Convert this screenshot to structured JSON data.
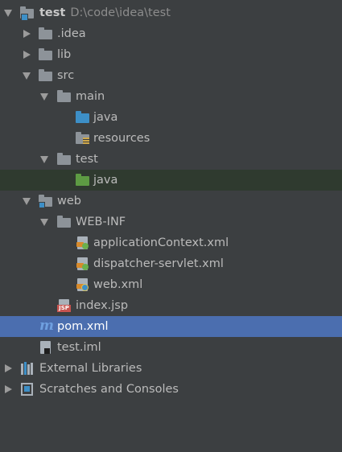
{
  "project_tree": {
    "root": {
      "name": "test",
      "path": "D:\\code\\idea\\test"
    },
    "items": [
      {
        "label": ".idea"
      },
      {
        "label": "lib"
      },
      {
        "label": "src"
      },
      {
        "label": "main"
      },
      {
        "label": "java"
      },
      {
        "label": "resources"
      },
      {
        "label": "test"
      },
      {
        "label": "java"
      },
      {
        "label": "web"
      },
      {
        "label": "WEB-INF"
      },
      {
        "label": "applicationContext.xml"
      },
      {
        "label": "dispatcher-servlet.xml"
      },
      {
        "label": "web.xml"
      },
      {
        "label": "index.jsp"
      },
      {
        "label": "pom.xml"
      },
      {
        "label": "test.iml"
      },
      {
        "label": "External Libraries"
      },
      {
        "label": "Scratches and Consoles"
      }
    ],
    "icon_texts": {
      "jsp_badge": "JSP",
      "maven_m": "m"
    }
  },
  "colors": {
    "background": "#3c3f41",
    "selection": "#4b6eaf",
    "test_source_highlight": "#2f3a2f",
    "source_folder": "#3d8fc7",
    "test_folder": "#5d9b43",
    "folder": "#8d9399"
  }
}
